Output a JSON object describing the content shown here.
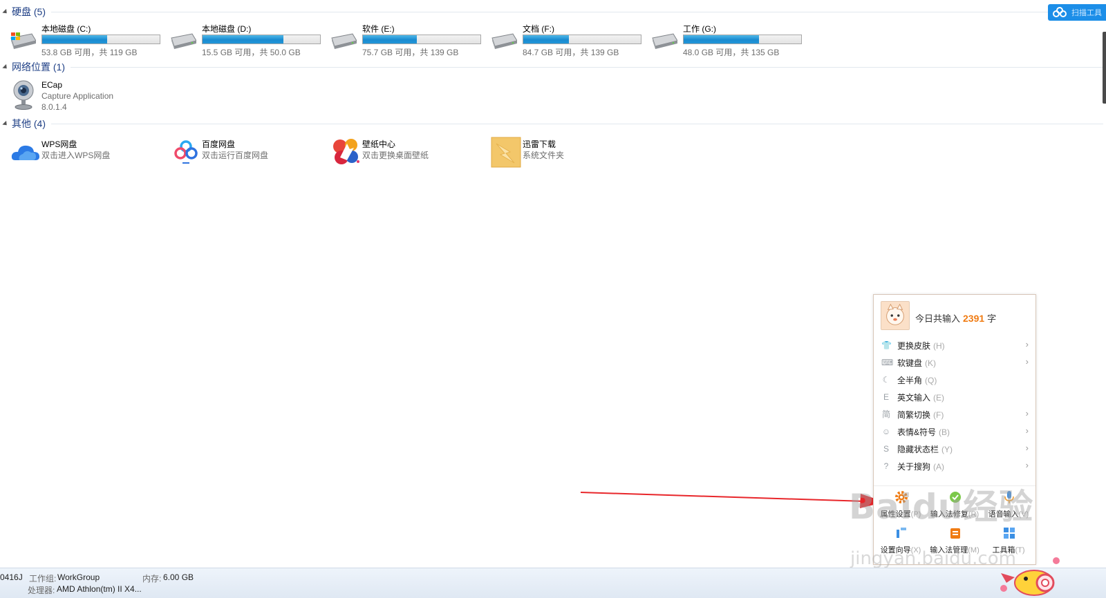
{
  "groups": {
    "drives": {
      "title": "硬盘 (5)"
    },
    "network": {
      "title": "网络位置 (1)"
    },
    "other": {
      "title": "其他 (4)"
    }
  },
  "drives": [
    {
      "name": "本地磁盘 (C:)",
      "free": "53.8 GB 可用，共 119 GB",
      "used_fraction": 0.55,
      "icon": "windows-drive-icon"
    },
    {
      "name": "本地磁盘 (D:)",
      "free": "15.5 GB 可用，共 50.0 GB",
      "used_fraction": 0.69,
      "icon": "hard-drive-icon"
    },
    {
      "name": "软件 (E:)",
      "free": "75.7 GB 可用，共 139 GB",
      "used_fraction": 0.46,
      "icon": "hard-drive-icon"
    },
    {
      "name": "文档 (F:)",
      "free": "84.7 GB 可用，共 139 GB",
      "used_fraction": 0.39,
      "icon": "hard-drive-icon"
    },
    {
      "name": "工作 (G:)",
      "free": "48.0 GB 可用，共 135 GB",
      "used_fraction": 0.64,
      "icon": "hard-drive-icon"
    }
  ],
  "network_items": [
    {
      "name": "ECap",
      "desc": "Capture Application",
      "version": "8.0.1.4",
      "icon": "webcam-icon"
    }
  ],
  "other_items": [
    {
      "name": "WPS网盘",
      "desc": "双击进入WPS网盘",
      "icon": "wps-cloud-icon"
    },
    {
      "name": "百度网盘",
      "desc": "双击运行百度网盘",
      "icon": "baidu-netdisk-icon"
    },
    {
      "name": "壁纸中心",
      "desc": "双击更换桌面壁纸",
      "icon": "wallpaper-icon"
    },
    {
      "name": "迅雷下载",
      "desc": "系统文件夹",
      "icon": "thunder-folder-icon"
    }
  ],
  "status_bar": {
    "computer": "0416J",
    "workgroup_label": "工作组:",
    "workgroup": "WorkGroup",
    "memory_label": "内存:",
    "memory": "6.00 GB",
    "cpu_label": "处理器:",
    "cpu": "AMD Athlon(tm) II X4..."
  },
  "ime_menu": {
    "today_prefix": "今日共输入",
    "today_count": "2391",
    "today_suffix": "字",
    "items": [
      {
        "label": "更换皮肤",
        "key": "(H)",
        "submenu": true,
        "icon": "shirt-icon"
      },
      {
        "label": "软键盘",
        "key": "(K)",
        "submenu": true,
        "icon": "keyboard-icon"
      },
      {
        "label": "全半角",
        "key": "(Q)",
        "submenu": false,
        "icon": "moon-icon"
      },
      {
        "label": "英文输入",
        "key": "(E)",
        "submenu": false,
        "icon": "english-icon"
      },
      {
        "label": "简繁切换",
        "key": "(F)",
        "submenu": true,
        "icon": "simplified-icon"
      },
      {
        "label": "表情&符号",
        "key": "(B)",
        "submenu": true,
        "icon": "smiley-icon"
      },
      {
        "label": "隐藏状态栏",
        "key": "(Y)",
        "submenu": true,
        "icon": "hide-statusbar-icon"
      },
      {
        "label": "关于搜狗",
        "key": "(A)",
        "submenu": true,
        "icon": "question-icon"
      }
    ],
    "tools": [
      {
        "label": "属性设置",
        "key": "(P)",
        "icon": "gear-icon"
      },
      {
        "label": "输入法修复",
        "key": "(R)",
        "icon": "repair-icon"
      },
      {
        "label": "语音输入",
        "key": "(V)",
        "icon": "microphone-icon"
      },
      {
        "label": "设置向导",
        "key": "(X)",
        "icon": "wizard-icon"
      },
      {
        "label": "输入法管理",
        "key": "(M)",
        "icon": "manage-icon"
      },
      {
        "label": "工具箱",
        "key": "(T)",
        "icon": "toolbox-icon"
      }
    ]
  },
  "cloud_badge": {
    "text": "扫描工具",
    "icon": "baidu-cloud-icon"
  },
  "watermark": {
    "line1": "Baidu经验",
    "line2": "jingyan.baidu.com"
  },
  "colors": {
    "accent": "#1e3f85",
    "bar_fill": "#1a8bd0",
    "count_orange": "#f07b12",
    "arrow_red": "#e8262a"
  }
}
